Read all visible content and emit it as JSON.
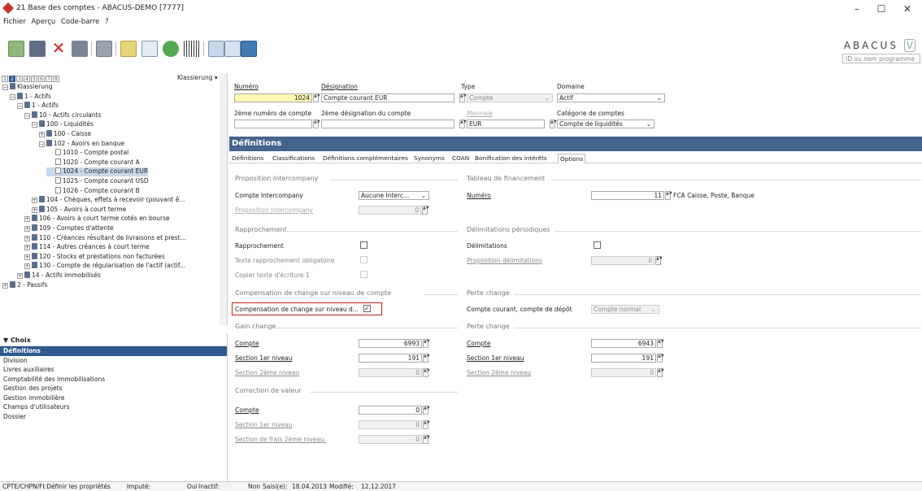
{
  "window": {
    "title": "21 Base des comptes - ABACUS-DEMO [7777]",
    "minimize": "–",
    "maximize": "☐",
    "close": "✕"
  },
  "menu": [
    "Fichier",
    "Aperçu",
    "Code-barre",
    "?"
  ],
  "brand": {
    "logo": "ABACUS",
    "logo_badge": "V",
    "program_placeholder": "ID ou nom programme"
  },
  "tree": {
    "levels": [
      "1",
      "2",
      "3",
      "4",
      "5",
      "6",
      "7",
      "8"
    ],
    "filter_label": "Klassierung",
    "rows": [
      {
        "label": "Klassierung",
        "indent": 0,
        "icon": "folder",
        "exp": "−"
      },
      {
        "label": "1 - Actifs",
        "indent": 1,
        "icon": "folder",
        "exp": "−"
      },
      {
        "label": "1 - Actifs",
        "indent": 2,
        "icon": "folder",
        "exp": "−"
      },
      {
        "label": "10 - Actifs circulants",
        "indent": 3,
        "icon": "folder",
        "exp": "−"
      },
      {
        "label": "100 - Liquidités",
        "indent": 4,
        "icon": "folder",
        "exp": "−"
      },
      {
        "label": "100 - Caisse",
        "indent": 5,
        "icon": "folder",
        "exp": "+"
      },
      {
        "label": "102 - Avoirs en banque",
        "indent": 5,
        "icon": "folder",
        "exp": "−"
      },
      {
        "label": "1010 - Compte postal",
        "indent": 6,
        "icon": "page",
        "exp": ""
      },
      {
        "label": "1020 - Compte courant A",
        "indent": 6,
        "icon": "page",
        "exp": ""
      },
      {
        "label": "1024 - Compte courant EUR",
        "indent": 6,
        "icon": "page",
        "exp": "",
        "selected": true
      },
      {
        "label": "1025 - Compte courant USD",
        "indent": 6,
        "icon": "page",
        "exp": ""
      },
      {
        "label": "1026 - Compte courant B",
        "indent": 6,
        "icon": "page",
        "exp": ""
      },
      {
        "label": "104 - Chèques, effets à recevoir (pouvant ê...",
        "indent": 4,
        "icon": "folder",
        "exp": "+"
      },
      {
        "label": "105 - Avoirs à court terme",
        "indent": 4,
        "icon": "folder",
        "exp": "+"
      },
      {
        "label": "106 - Avoirs à court terme cotés en bourse",
        "indent": 3,
        "icon": "folder",
        "exp": "+"
      },
      {
        "label": "109 - Comptes d'attente",
        "indent": 3,
        "icon": "folder",
        "exp": "+"
      },
      {
        "label": "110 - Créances résultant de livraisons et prest...",
        "indent": 3,
        "icon": "folder",
        "exp": "+"
      },
      {
        "label": "114 - Autres créances à court terme",
        "indent": 3,
        "icon": "folder",
        "exp": "+"
      },
      {
        "label": "120 - Stocks et prestations non facturées",
        "indent": 3,
        "icon": "folder",
        "exp": "+"
      },
      {
        "label": "130 - Compte de régularisation de l'actif (actif...",
        "indent": 3,
        "icon": "folder",
        "exp": "+"
      },
      {
        "label": "14 - Actifs immobilisés",
        "indent": 2,
        "icon": "folder",
        "exp": "+"
      },
      {
        "label": "2 - Passifs",
        "indent": 0,
        "icon": "folder",
        "exp": "+"
      }
    ]
  },
  "choix": {
    "header": "▼ Choix",
    "items": [
      "Définitions",
      "Division",
      "Livres auxiliaires",
      "Comptabilité des immobilisations",
      "Gestion des projets",
      "Gestion immobilière",
      "Champs d'utilisateurs",
      "Dossier"
    ]
  },
  "form": {
    "numero_label": "Numéro",
    "numero_value": "1024",
    "designation_label": "Désignation",
    "designation_value": "Compte courant EUR",
    "type_label": "Type",
    "type_value": "Compte",
    "domaine_label": "Domaine",
    "domaine_value": "Actif",
    "num2_label": "2ème numéro de compte",
    "des2_label": "2ème désignation du compte",
    "monnaie_label": "Monnaie",
    "monnaie_value": "EUR",
    "categorie_label": "Catégorie de comptes",
    "categorie_value": "Compte de liquidités"
  },
  "section_bar": "Définitions",
  "tabs": [
    "Définitions",
    "Classifications",
    "Définitions complémentaires",
    "Synonyms",
    "COAN",
    "Bonification des intérêts",
    "Options"
  ],
  "options": {
    "proposition_ic": "Proposition Intercompany",
    "compte_ic_label": "Compte Intercompany",
    "compte_ic_value": "Aucune Interc...",
    "proposition_ic_link": "Proposition Intercompany",
    "proposition_ic_value": "0",
    "tableau_fin": "Tableau de financement",
    "tf_numero_label": "Numéro",
    "tf_numero_value": "11",
    "tf_numero_desc": "FCA Caisse, Poste, Banque",
    "rapprochement": "Rapprochement",
    "rapprochement_label": "Rapprochement",
    "texte_rapp_label": "Texte rapprochement obligatoire",
    "copier_label": "Copier texte d'écriture 1",
    "delim_periodiques": "Délimitations périodiques",
    "delim_label": "Délimitations",
    "prop_delim_label": "Proposition délimitations",
    "prop_delim_value": "0",
    "comp_change_sect": "Compensation de change sur niveau de compte",
    "comp_change_label": "Compensation de change sur niveau d...",
    "perte_change_sect": "Perte change",
    "compte_courant_label": "Compte courant, compte de dépôt",
    "compte_courant_value": "Compte normal",
    "gain_change_sect": "Gain change",
    "gain_compte_label": "Compte",
    "gain_compte_value": "6993",
    "gain_sec1_label": "Section 1er niveau",
    "gain_sec1_value": "191",
    "gain_sec2_label": "Section 2ème niveau",
    "gain_sec2_value": "0",
    "perte_change_sect2": "Perte change",
    "perte_compte_label": "Compte",
    "perte_compte_value": "6943",
    "perte_sec1_label": "Section 1er niveau",
    "perte_sec1_value": "191",
    "perte_sec2_label": "Section 2ème niveau",
    "perte_sec2_value": "0",
    "correction_sect": "Correction de valeur",
    "corr_compte_label": "Compte",
    "corr_compte_value": "0",
    "corr_sec1_label": "Section 1er niveau",
    "corr_sec1_value": "0",
    "corr_frais_label": "Section de frais 2ème niveau.",
    "corr_frais_value": "0"
  },
  "status": {
    "s1": "CPTE/CHPN/FI:Définir les propriétés",
    "s2": "Imputé:",
    "s3": "Oui",
    "s4": "Inactif:",
    "s5": "Non",
    "s6": "Saisi(e):",
    "s7": "18.04.2013",
    "s8": "Modifié:",
    "s9": "12.12.2017"
  },
  "colors": {
    "accent": "#45638c",
    "selection": "#2f5a8f",
    "highlight": "#c42020"
  }
}
